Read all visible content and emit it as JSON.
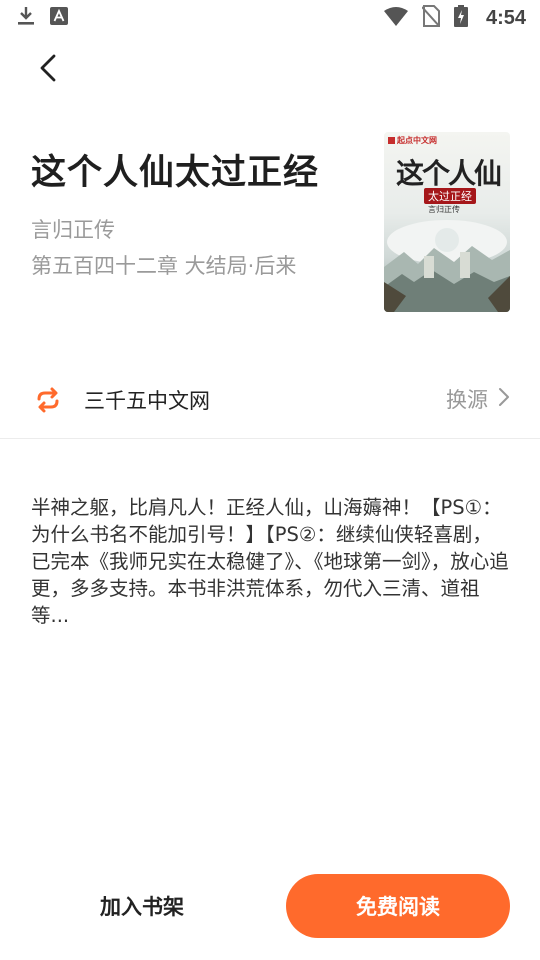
{
  "status_bar": {
    "time": "4:54",
    "icons": [
      "download-icon",
      "a-badge-icon",
      "wifi-icon",
      "no-sim-icon",
      "battery-charging-icon"
    ]
  },
  "nav": {
    "back_icon": "chevron-left-icon"
  },
  "book": {
    "title": "这个人仙太过正经",
    "author": "言归正传",
    "latest_chapter": "第五百四十二章 大结局·后来",
    "cover": {
      "publisher": "起点中文网",
      "title": "这个人仙",
      "subtitle": "太过正经",
      "author": "言归正传"
    }
  },
  "source": {
    "icon": "refresh-icon",
    "name": "三千五中文网",
    "change_label": "换源"
  },
  "description": "半神之躯，比肩凡人！正经人仙，山海薅神！【PS①：为什么书名不能加引号！】【PS②：继续仙侠轻喜剧，已完本《我师兄实在太稳健了》、《地球第一剑》，放心追更，多多支持。本书非洪荒体系，勿代入三清、道祖等...",
  "actions": {
    "add_to_shelf": "加入书架",
    "read_free": "免费阅读"
  },
  "colors": {
    "accent": "#ff6a2c",
    "muted_text": "#9a9a9a"
  }
}
